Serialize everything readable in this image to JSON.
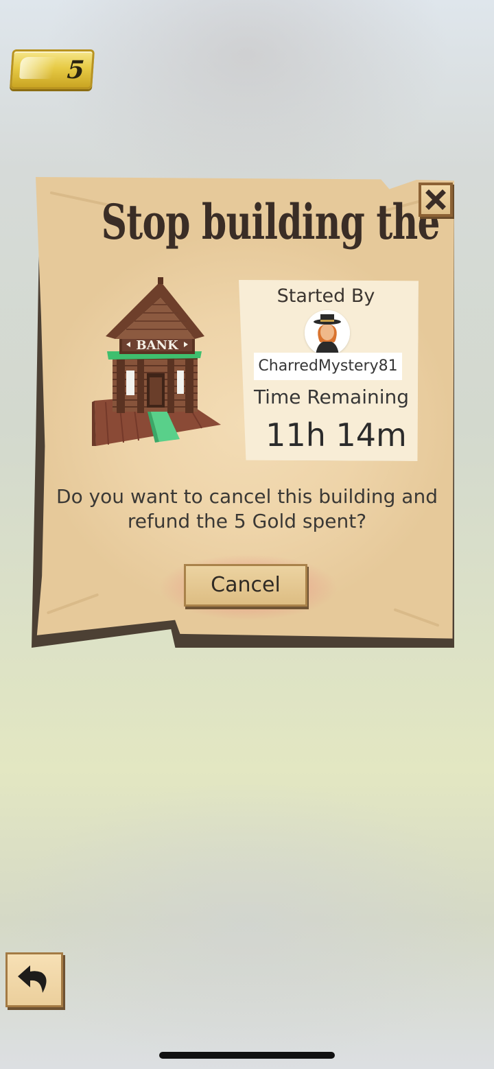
{
  "hud": {
    "gold_count": "5"
  },
  "dialog": {
    "title": "Stop building the",
    "building_sign": "BANK",
    "started_by_label": "Started By",
    "username": "CharredMystery81",
    "time_remaining_label": "Time Remaining",
    "time_remaining_value": "11h 14m",
    "message": "Do you want to cancel this building and refund the 5 Gold spent?",
    "cancel_label": "Cancel"
  },
  "icons": {
    "close": "close-icon",
    "back": "back-arrow-icon",
    "gold": "gold-bar-icon",
    "avatar": "player-avatar"
  },
  "colors": {
    "parchment": "#eed4a9",
    "gold": "#e7cb46",
    "cancel_glow": "#e86e6e",
    "bank_sign_green": "#3fbf6e"
  }
}
